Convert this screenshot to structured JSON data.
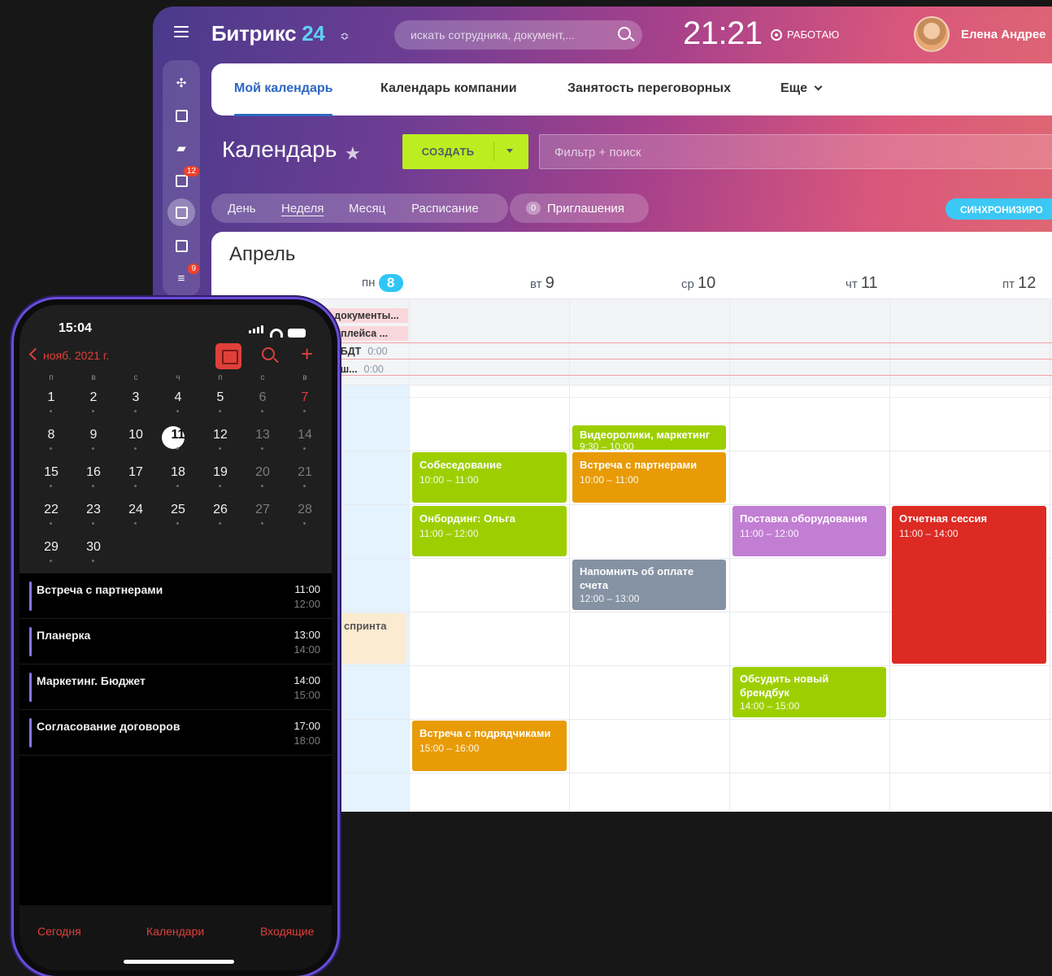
{
  "header": {
    "logo_main": "Битрикс",
    "logo_num": "24",
    "search_placeholder": "искать сотрудника, документ,...",
    "clock": "21:21",
    "work_status": "РАБОТАЮ",
    "username": "Елена Андрее"
  },
  "leftbar": {
    "tasks_badge": "12",
    "feed_badge": "9"
  },
  "tabs": [
    "Мой календарь",
    "Календарь компании",
    "Занятость переговорных",
    "Еще"
  ],
  "toolbar": {
    "title": "Календарь",
    "create_label": "СОЗДАТЬ",
    "filter_placeholder": "Фильтр + поиск",
    "views": [
      "День",
      "Неделя",
      "Месяц",
      "Расписание"
    ],
    "invites_count": "0",
    "invites_label": "Приглашения",
    "sync_label": "СИНХРОНИЗИРО"
  },
  "calendar": {
    "month": "Апрель",
    "days": [
      {
        "dow": "пн",
        "num": "8"
      },
      {
        "dow": "вт",
        "num": "9"
      },
      {
        "dow": "ср",
        "num": "10"
      },
      {
        "dow": "чт",
        "num": "11"
      },
      {
        "dow": "пт",
        "num": "12"
      }
    ],
    "allday": [
      {
        "name": "ь документы...",
        "time": ""
      },
      {
        "name": "кетплейса ...",
        "time": ""
      },
      {
        "name": "ля БДТ",
        "time": "0:00"
      },
      {
        "name": "ля ш...",
        "time": "0:00"
      }
    ],
    "events": [
      {
        "name": "Видеоролики, маркетинг",
        "time": "9:30 – 10:00"
      },
      {
        "name": "Собеседование",
        "time": "10:00 – 11:00"
      },
      {
        "name": "Встреча с партнерами",
        "time": "10:00 – 11:00"
      },
      {
        "name": "Онбординг: Ольга",
        "time": "11:00 – 12:00"
      },
      {
        "name": "Поставка оборудования",
        "time": "11:00 – 12:00"
      },
      {
        "name": "Отчетная сессия",
        "time": "11:00 – 14:00"
      },
      {
        "name": "Напомнить об оплате счета",
        "time": "12:00 – 13:00"
      },
      {
        "name": "спринта",
        "time": ""
      },
      {
        "name": "Обсудить новый брендбук",
        "time": "14:00 – 15:00"
      },
      {
        "name": "Встреча с подрядчиками",
        "time": "15:00 – 16:00"
      }
    ]
  },
  "phone": {
    "time": "15:04",
    "back_label": "нояб. 2021 г.",
    "weekdays": [
      "п",
      "в",
      "с",
      "ч",
      "п",
      "с",
      "в"
    ],
    "weeks": [
      [
        "1",
        "2",
        "3",
        "4",
        "5",
        "6",
        "7"
      ],
      [
        "8",
        "9",
        "10",
        "11",
        "12",
        "13",
        "14"
      ],
      [
        "15",
        "16",
        "17",
        "18",
        "19",
        "20",
        "21"
      ],
      [
        "22",
        "23",
        "24",
        "25",
        "26",
        "27",
        "28"
      ],
      [
        "29",
        "30"
      ]
    ],
    "events": [
      {
        "name": "Встреча с партнерами",
        "start": "11:00",
        "end": "12:00"
      },
      {
        "name": "Планерка",
        "start": "13:00",
        "end": "14:00"
      },
      {
        "name": "Маркетинг. Бюджет",
        "start": "14:00",
        "end": "15:00"
      },
      {
        "name": "Согласование договоров",
        "start": "17:00",
        "end": "18:00"
      }
    ],
    "tabbar": [
      "Сегодня",
      "Календари",
      "Входящие"
    ]
  }
}
